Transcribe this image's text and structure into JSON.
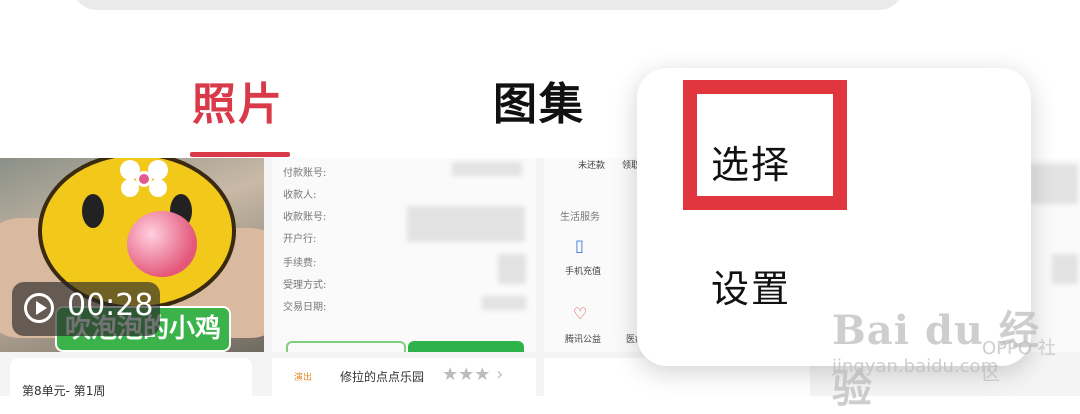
{
  "tabs": {
    "photos": "照片",
    "albums": "图集"
  },
  "video": {
    "duration": "00:28",
    "caption": "吹泡泡的小鸡"
  },
  "receipt": {
    "fields": [
      "付款账号:",
      "收款人:",
      "收款账号:",
      "开户行:",
      "手续费:",
      "受理方式:",
      "交易日期:"
    ]
  },
  "services": {
    "title": "生活服务",
    "items": [
      "手机充值",
      "腾讯公益",
      "医疗"
    ],
    "top_labels": [
      "未还款",
      "领取"
    ]
  },
  "row2": {
    "card1": "第8单元- 第1周",
    "card2_tag": "演出",
    "card2": "修拉的点点乐园"
  },
  "menu": {
    "select": "选择",
    "settings": "设置"
  },
  "watermark": {
    "main": "Bai du 经验",
    "sub": "jingyan.baidu.com",
    "oppo": "OPPO 社区"
  }
}
